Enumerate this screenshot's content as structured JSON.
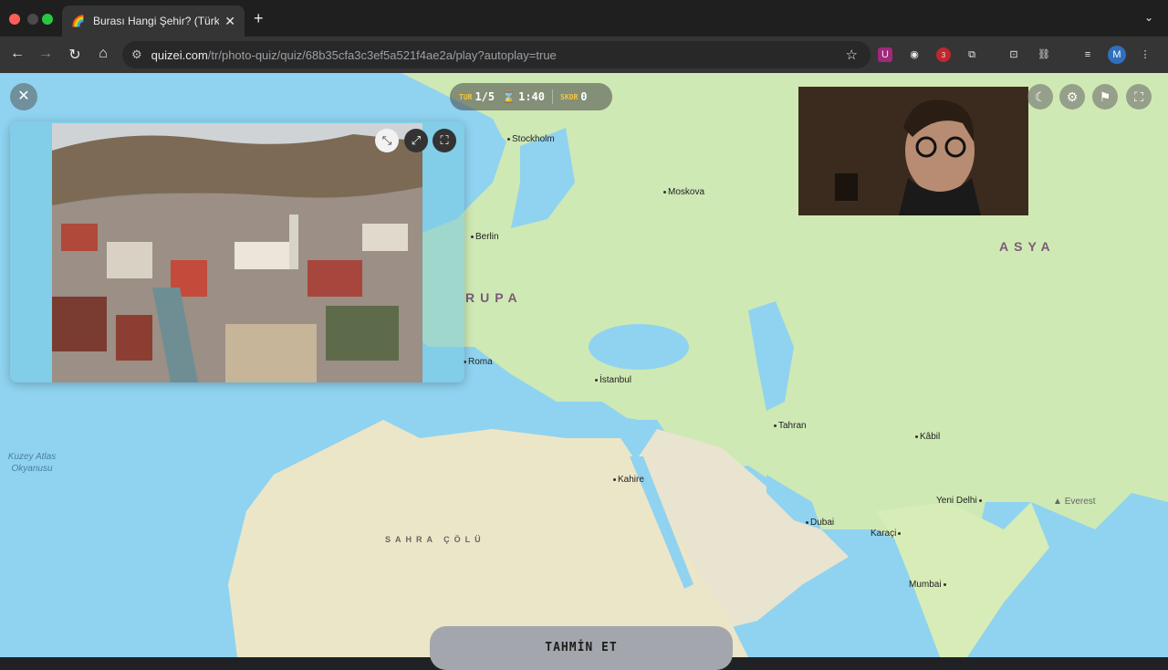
{
  "browser": {
    "tab_title": "Burası Hangi Şehir? (Türkiye)",
    "url_host": "quizei.com",
    "url_path": "/tr/photo-quiz/quiz/68b35cfa3c3ef5a521f4ae2a/play?autoplay=true",
    "extension_badge": "3",
    "profile_initial": "M"
  },
  "hud": {
    "round_label": "TUR",
    "round_value": "1/5",
    "timer_value": "1:40",
    "score_label": "SKOR",
    "score_value": "0"
  },
  "map": {
    "cities": [
      {
        "name": "Stockholm"
      },
      {
        "name": "Moskova"
      },
      {
        "name": "Berlin"
      },
      {
        "name": "Roma"
      },
      {
        "name": "İstanbul"
      },
      {
        "name": "Tahran"
      },
      {
        "name": "Kâbil"
      },
      {
        "name": "Kahire"
      },
      {
        "name": "Yeni Delhi"
      },
      {
        "name": "Dubai"
      },
      {
        "name": "Karaçi"
      },
      {
        "name": "Mumbai"
      },
      {
        "name": "Everest"
      }
    ],
    "regions": {
      "europe": "RUPA",
      "asia": "ASYA"
    },
    "ocean": "Kuzey Atlas Okyanusu",
    "desert": "SAHRA ÇÖLÜ"
  },
  "actions": {
    "guess_label": "TAHMİN ET"
  },
  "icons": {
    "close": "close-icon",
    "minimize": "collapse-icon",
    "expand": "expand-icon",
    "fullscreen": "fullscreen-icon",
    "theme": "moon-icon",
    "settings": "gear-icon",
    "report": "flag-icon"
  },
  "colors": {
    "sea": "#8fd3f0",
    "land": "#cfe9b4",
    "accent": "#f5c542"
  }
}
